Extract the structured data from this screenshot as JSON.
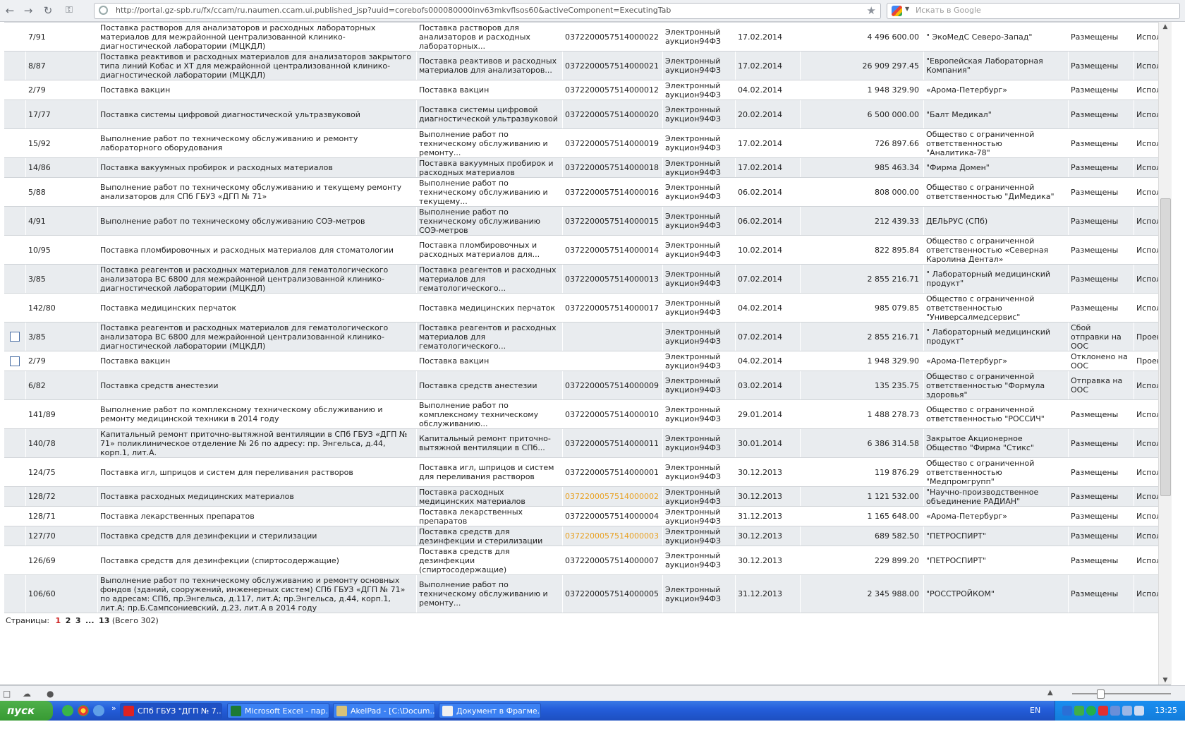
{
  "browser": {
    "url": "http://portal.gz-spb.ru/fx/ccam/ru.naumen.ccam.ui.published_jsp?uuid=corebofs000080000inv63mkvflsos60&activeComponent=ExecutingTab",
    "search_placeholder": "Искать в Google",
    "back_icon": "back-arrow-icon",
    "forward_icon": "forward-arrow-icon",
    "reload_icon": "reload-icon",
    "key_icon": "key-icon"
  },
  "table": {
    "top_partial": {
      "name": "диагностической лаборатории (МЦКДЛ)",
      "short": "анализаторов..."
    },
    "rows": [
      {
        "cb": false,
        "num": "7/91",
        "name": "Поставка растворов для анализаторов и расходных лабораторных материалов для межрайонной централизованной клинико-диагностической лаборатории (МЦКДЛ)",
        "short": "Поставка растворов для анализаторов и расходных лабораторных...",
        "reg": "0372200057514000022",
        "reg_highlight": false,
        "method": "Электронный аукцион94ФЗ",
        "date": "17.02.2014",
        "sum": "4 496 600.00",
        "supplier": "\" ЭкоМедС Северо-Запад\"",
        "status": "Размещены",
        "exec": "Исполняется"
      },
      {
        "cb": false,
        "num": "8/87",
        "name": "Поставка реактивов и расходных материалов для анализаторов закрытого типа линий Кобас и ХТ для межрайонной централизованной клинико-диагностической лаборатории (МЦКДЛ)",
        "short": "Поставка реактивов и расходных материалов для анализаторов...",
        "reg": "0372200057514000021",
        "reg_highlight": false,
        "method": "Электронный аукцион94ФЗ",
        "date": "17.02.2014",
        "sum": "26 909 297.45",
        "supplier": "\"Европейская Лабораторная Компания\"",
        "status": "Размещены",
        "exec": "Исполняется"
      },
      {
        "cb": false,
        "num": "2/79",
        "name": "Поставка вакцин",
        "short": "Поставка вакцин",
        "reg": "0372200057514000012",
        "reg_highlight": false,
        "method": "Электронный аукцион94ФЗ",
        "date": "04.02.2014",
        "sum": "1 948 329.90",
        "supplier": "«Арома-Петербург»",
        "status": "Размещены",
        "exec": "Исполняется"
      },
      {
        "cb": false,
        "num": "17/77",
        "name": "Поставка системы цифровой диагностической ультразвуковой",
        "short": "Поставка системы цифровой диагностической ультразвуковой",
        "reg": "0372200057514000020",
        "reg_highlight": false,
        "method": "Электронный аукцион94ФЗ",
        "date": "20.02.2014",
        "sum": "6 500 000.00",
        "supplier": "\"Балт Медикал\"",
        "status": "Размещены",
        "exec": "Исполняется"
      },
      {
        "cb": false,
        "num": "15/92",
        "name": "Выполнение работ по техническому обслуживанию и ремонту лабораторного оборудования",
        "short": "Выполнение работ по техническому обслуживанию и ремонту...",
        "reg": "0372200057514000019",
        "reg_highlight": false,
        "method": "Электронный аукцион94ФЗ",
        "date": "17.02.2014",
        "sum": "726 897.66",
        "supplier": "Общество с ограниченной ответственностью \"Аналитика-78\"",
        "status": "Размещены",
        "exec": "Исполняется"
      },
      {
        "cb": false,
        "num": "14/86",
        "name": "Поставка вакуумных пробирок и расходных материалов",
        "short": "Поставка вакуумных пробирок и расходных материалов",
        "reg": "0372200057514000018",
        "reg_highlight": false,
        "method": "Электронный аукцион94ФЗ",
        "date": "17.02.2014",
        "sum": "985 463.34",
        "supplier": "\"Фирма Домен\"",
        "status": "Размещены",
        "exec": "Исполняется"
      },
      {
        "cb": false,
        "num": "5/88",
        "name": "Выполнение работ по техническому обслуживанию и текущему ремонту анализаторов для СПб ГБУЗ «ДГП № 71»",
        "short": "Выполнение работ по техническому обслуживанию и текущему...",
        "reg": "0372200057514000016",
        "reg_highlight": false,
        "method": "Электронный аукцион94ФЗ",
        "date": "06.02.2014",
        "sum": "808 000.00",
        "supplier": "Общество с ограниченной ответственностью \"ДиМедика\"",
        "status": "Размещены",
        "exec": "Исполняется"
      },
      {
        "cb": false,
        "num": "4/91",
        "name": "Выполнение работ по техническому обслуживанию СОЭ-метров",
        "short": "Выполнение работ по техническому обслуживанию СОЭ-метров",
        "reg": "0372200057514000015",
        "reg_highlight": false,
        "method": "Электронный аукцион94ФЗ",
        "date": "06.02.2014",
        "sum": "212 439.33",
        "supplier": "ДЕЛЬРУС (СПб)",
        "status": "Размещены",
        "exec": "Исполняется"
      },
      {
        "cb": false,
        "num": "10/95",
        "name": "Поставка пломбировочных и расходных материалов для стоматологии",
        "short": "Поставка пломбировочных и расходных материалов для...",
        "reg": "0372200057514000014",
        "reg_highlight": false,
        "method": "Электронный аукцион94ФЗ",
        "date": "10.02.2014",
        "sum": "822 895.84",
        "supplier": "Общество с ограниченной ответственностью «Северная Каролина Дентал»",
        "status": "Размещены",
        "exec": "Исполняется"
      },
      {
        "cb": false,
        "num": "3/85",
        "name": "Поставка реагентов и расходных материалов для гематологического анализатора ВС 6800 для межрайонной централизованной клинико-диагностической лаборатории (МЦКДЛ)",
        "short": "Поставка реагентов и расходных материалов для гематологического...",
        "reg": "0372200057514000013",
        "reg_highlight": false,
        "method": "Электронный аукцион94ФЗ",
        "date": "07.02.2014",
        "sum": "2 855 216.71",
        "supplier": "\" Лабораторный медицинский продукт\"",
        "status": "Размещены",
        "exec": "Исполняется"
      },
      {
        "cb": false,
        "num": "142/80",
        "name": "Поставка медицинских перчаток",
        "short": "Поставка медицинских перчаток",
        "reg": "0372200057514000017",
        "reg_highlight": false,
        "method": "Электронный аукцион94ФЗ",
        "date": "04.02.2014",
        "sum": "985 079.85",
        "supplier": "Общество с ограниченной ответственностью \"Универсалмедсервис\"",
        "status": "Размещены",
        "exec": "Исполняется"
      },
      {
        "cb": true,
        "num": "3/85",
        "name": "Поставка реагентов и расходных материалов для гематологического анализатора ВС 6800 для межрайонной централизованной клинико-диагностической лаборатории (МЦКДЛ)",
        "short": "Поставка реагентов и расходных материалов для гематологического...",
        "reg": "",
        "reg_highlight": false,
        "method": "Электронный аукцион94ФЗ",
        "date": "07.02.2014",
        "sum": "2 855 216.71",
        "supplier": "\" Лабораторный медицинский продукт\"",
        "status": "Сбой отправки на ООС",
        "exec": "Проект"
      },
      {
        "cb": true,
        "num": "2/79",
        "name": "Поставка вакцин",
        "short": "Поставка вакцин",
        "reg": "",
        "reg_highlight": false,
        "method": "Электронный аукцион94ФЗ",
        "date": "04.02.2014",
        "sum": "1 948 329.90",
        "supplier": "«Арома-Петербург»",
        "status": "Отклонено на ООС",
        "exec": "Проект"
      },
      {
        "cb": false,
        "num": "6/82",
        "name": "Поставка средств анестезии",
        "short": "Поставка средств анестезии",
        "reg": "0372200057514000009",
        "reg_highlight": false,
        "method": "Электронный аукцион94ФЗ",
        "date": "03.02.2014",
        "sum": "135 235.75",
        "supplier": "Общество с ограниченной ответственностью \"Формула здоровья\"",
        "status": "Отправка на ООС",
        "exec": "Исполняется"
      },
      {
        "cb": false,
        "num": "141/89",
        "name": "Выполнение работ по комплексному техническому обслуживанию и ремонту медицинской техники в 2014 году",
        "short": "Выполнение работ по комплексному техническому обслуживанию...",
        "reg": "0372200057514000010",
        "reg_highlight": false,
        "method": "Электронный аукцион94ФЗ",
        "date": "29.01.2014",
        "sum": "1 488 278.73",
        "supplier": "Общество с ограниченной ответственностью \"РОССИЧ\"",
        "status": "Размещены",
        "exec": "Исполняется"
      },
      {
        "cb": false,
        "num": "140/78",
        "name": "Капитальный ремонт приточно-вытяжной вентиляции в СПб ГБУЗ «ДГП № 71» поликлиническое отделение № 26 по адресу: пр. Энгельса, д.44, корп.1, лит.А.",
        "short": "Капитальный ремонт приточно-вытяжной вентиляции в СПб...",
        "reg": "0372200057514000011",
        "reg_highlight": false,
        "method": "Электронный аукцион94ФЗ",
        "date": "30.01.2014",
        "sum": "6 386 314.58",
        "supplier": "Закрытое Акционерное Общество \"Фирма \"Стикс\"",
        "status": "Размещены",
        "exec": "Исполняется"
      },
      {
        "cb": false,
        "num": "124/75",
        "name": "Поставка игл, шприцов и систем для переливания растворов",
        "short": "Поставка игл, шприцов и систем для переливания растворов",
        "reg": "0372200057514000001",
        "reg_highlight": false,
        "method": "Электронный аукцион94ФЗ",
        "date": "30.12.2013",
        "sum": "119 876.29",
        "supplier": "Общество с ограниченной ответственностью \"Медпромгрупп\"",
        "status": "Размещены",
        "exec": "Исполняется"
      },
      {
        "cb": false,
        "num": "128/72",
        "name": "Поставка расходных медицинских материалов",
        "short": "Поставка расходных медицинских материалов",
        "reg": "0372200057514000002",
        "reg_highlight": true,
        "method": "Электронный аукцион94ФЗ",
        "date": "30.12.2013",
        "sum": "1 121 532.00",
        "supplier": "\"Научно-производственное объединение РАДИАН\"",
        "status": "Размещены",
        "exec": "Исполняется"
      },
      {
        "cb": false,
        "num": "128/71",
        "name": "Поставка лекарственных препаратов",
        "short": "Поставка лекарственных препаратов",
        "reg": "0372200057514000004",
        "reg_highlight": false,
        "method": "Электронный аукцион94ФЗ",
        "date": "31.12.2013",
        "sum": "1 165 648.00",
        "supplier": "«Арома-Петербург»",
        "status": "Размещены",
        "exec": "Исполняется"
      },
      {
        "cb": false,
        "num": "127/70",
        "name": "Поставка средств для дезинфекции и стерилизации",
        "short": "Поставка средств для дезинфекции и стерилизации",
        "reg": "0372200057514000003",
        "reg_highlight": true,
        "method": "Электронный аукцион94ФЗ",
        "date": "30.12.2013",
        "sum": "689 582.50",
        "supplier": "\"ПЕТРОСПИРТ\"",
        "status": "Размещены",
        "exec": "Исполняется"
      },
      {
        "cb": false,
        "num": "126/69",
        "name": "Поставка средств для дезинфекции (спиртосодержащие)",
        "short": "Поставка средств для дезинфекции (спиртосодержащие)",
        "reg": "0372200057514000007",
        "reg_highlight": false,
        "method": "Электронный аукцион94ФЗ",
        "date": "30.12.2013",
        "sum": "229 899.20",
        "supplier": "\"ПЕТРОСПИРТ\"",
        "status": "Размещены",
        "exec": "Исполняется"
      },
      {
        "cb": false,
        "num": "106/60",
        "name": "Выполнение работ по техническому обслуживанию и ремонту основных фондов (зданий, сооружений, инженерных систем) СПб ГБУЗ «ДГП № 71» по адресам: СПб, пр.Энгельса, д.117, лит.А; пр.Энгельса, д.44, корп.1, лит.А; пр.Б.Сампсониевский, д.23, лит.А в 2014 году",
        "short": "Выполнение работ по техническому обслуживанию и ремонту...",
        "reg": "0372200057514000005",
        "reg_highlight": false,
        "method": "Электронный аукцион94ФЗ",
        "date": "31.12.2013",
        "sum": "2 345 988.00",
        "supplier": "\"РОССТРОЙКОМ\"",
        "status": "Размещены",
        "exec": "Исполняется"
      }
    ],
    "row_heights": [
      41,
      41,
      28,
      41,
      41,
      28,
      41,
      41,
      41,
      41,
      41,
      41,
      28,
      41,
      41,
      41,
      41,
      28,
      28,
      28,
      41,
      54
    ]
  },
  "pager": {
    "label": "Страницы:",
    "pages": [
      "1",
      "2",
      "3"
    ],
    "ellipsis": "...",
    "last": "13",
    "total": "(Всего 302)"
  },
  "taskbar": {
    "start": "пуск",
    "tasks": [
      {
        "label": "СПб ГБУЗ \"ДГП № 7...",
        "active": true,
        "icon_color": "#d22"
      },
      {
        "label": "Microsoft Excel - пар...",
        "active": false,
        "icon_color": "#1d7a34"
      },
      {
        "label": "AkelPad - [C:\\Docum...",
        "active": false,
        "icon_color": "#d9c27a"
      },
      {
        "label": "Документ в Фрагме...",
        "active": false,
        "icon_color": "#f0f0f0"
      }
    ],
    "lang": "EN",
    "clock": "13:25"
  },
  "colors": {
    "row_odd": "#e9ecef",
    "row_even": "#ffffff",
    "link_highlight": "#e8a020",
    "pager_active": "#cc2020"
  }
}
